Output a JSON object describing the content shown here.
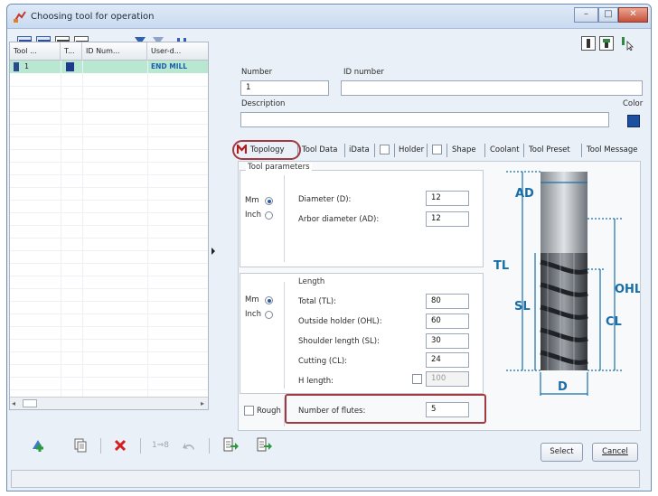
{
  "window": {
    "title": "Choosing tool for operation",
    "controls": {
      "minimize": "–",
      "maximize": "□",
      "close": "✕"
    }
  },
  "tool_list": {
    "columns": [
      "Tool ...",
      "T...",
      "ID Num...",
      "User-d..."
    ],
    "rows": [
      {
        "tool": "1",
        "color": "#1f3a8a",
        "id_number": "",
        "user_defined": "END MILL"
      }
    ]
  },
  "fields": {
    "number_label": "Number",
    "number_value": "1",
    "id_number_label": "ID number",
    "id_number_value": "",
    "description_label": "Description",
    "description_value": "",
    "color_label": "Color",
    "color_value": "#1d4fa0"
  },
  "tabs": [
    "Topology",
    "Tool Data",
    "iData",
    "Holder",
    "Shape",
    "Coolant",
    "Tool Preset",
    "Tool Message"
  ],
  "tool_parameters": {
    "title": "Tool parameters",
    "unit_mm": "Mm",
    "unit_inch": "Inch",
    "diameter_label": "Diameter (D):",
    "diameter_value": "12",
    "arbor_label": "Arbor diameter (AD):",
    "arbor_value": "12"
  },
  "length": {
    "title": "Length",
    "unit_mm": "Mm",
    "unit_inch": "Inch",
    "total_label": "Total (TL):",
    "total_value": "80",
    "outside_label": "Outside holder (OHL):",
    "outside_value": "60",
    "shoulder_label": "Shoulder length (SL):",
    "shoulder_value": "30",
    "cutting_label": "Cutting (CL):",
    "cutting_value": "24",
    "h_length_label": "H length:",
    "h_length_value": "100"
  },
  "rough_label": "Rough",
  "flutes_label": "Number of flutes:",
  "flutes_value": "5",
  "diagram_labels": {
    "ad": "AD",
    "tl": "TL",
    "sl": "SL",
    "ohl": "OHL",
    "cl": "CL",
    "d": "D"
  },
  "toolbar_bottom": {
    "renumber_label": "1⇒8"
  },
  "buttons": {
    "select": "Select",
    "cancel": "Cancel"
  },
  "colors": {
    "accent_red": "#a23a3f",
    "row_highlight": "#b9e8d2",
    "dimension": "#1a6ea8"
  }
}
